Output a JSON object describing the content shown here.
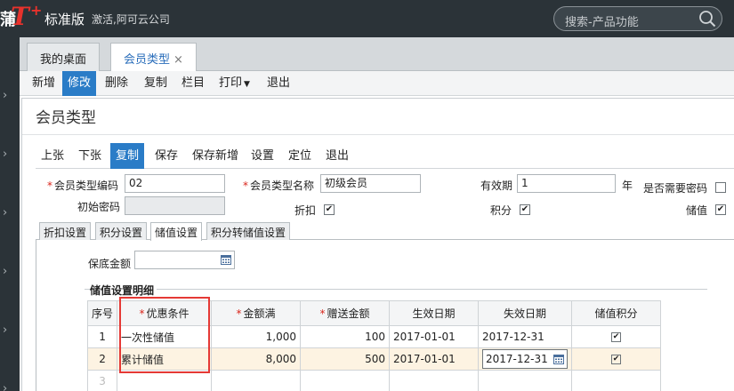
{
  "header": {
    "logo_cut": "蒲",
    "logo_text": "T",
    "logo_plus": "+",
    "edition": "标准版",
    "company": "激活,阿可云公司",
    "search_placeholder": "搜索-产品功能"
  },
  "tabs": [
    {
      "label": "我的桌面"
    },
    {
      "label": "会员类型",
      "close": "×"
    }
  ],
  "toolbar": [
    "新增",
    "修改",
    "删除",
    "复制",
    "栏目",
    "打印",
    "退出"
  ],
  "dialog": {
    "title": "会员类型",
    "toolbar": [
      "上张",
      "下张",
      "复制",
      "保存",
      "保存新增",
      "设置",
      "定位",
      "退出"
    ],
    "form": {
      "code_label": "会员类型编码",
      "code_value": "02",
      "name_label": "会员类型名称",
      "name_value": "初级会员",
      "validity_label": "有效期",
      "validity_value": "1",
      "validity_unit": "年",
      "need_password_label": "是否需要密码",
      "need_password": false,
      "init_password_label": "初始密码",
      "discount_label": "折扣",
      "discount": true,
      "points_label": "积分",
      "points": true,
      "stored_value_label": "储值",
      "stored_value": true
    },
    "subtabs": [
      "折扣设置",
      "积分设置",
      "储值设置",
      "积分转储值设置"
    ],
    "active_subtab": 2,
    "min_amount_label": "保底金额",
    "group_title": "储值设置明细",
    "table": {
      "columns": [
        "序号",
        "优惠条件",
        "金额满",
        "赠送金额",
        "生效日期",
        "失效日期",
        "储值积分"
      ],
      "required_columns": [
        1,
        2,
        3
      ],
      "rows": [
        {
          "idx": "1",
          "condition": "一次性储值",
          "amount": "1,000",
          "bonus": "100",
          "start": "2017-01-01",
          "end": "2017-12-31",
          "points": true
        },
        {
          "idx": "2",
          "condition": "累计储值",
          "amount": "8,000",
          "bonus": "500",
          "start": "2017-01-01",
          "end": "2017-12-31",
          "points": true
        },
        {
          "idx": "3",
          "condition": "",
          "amount": "",
          "bonus": "",
          "start": "",
          "end": "",
          "points": false
        }
      ]
    }
  }
}
